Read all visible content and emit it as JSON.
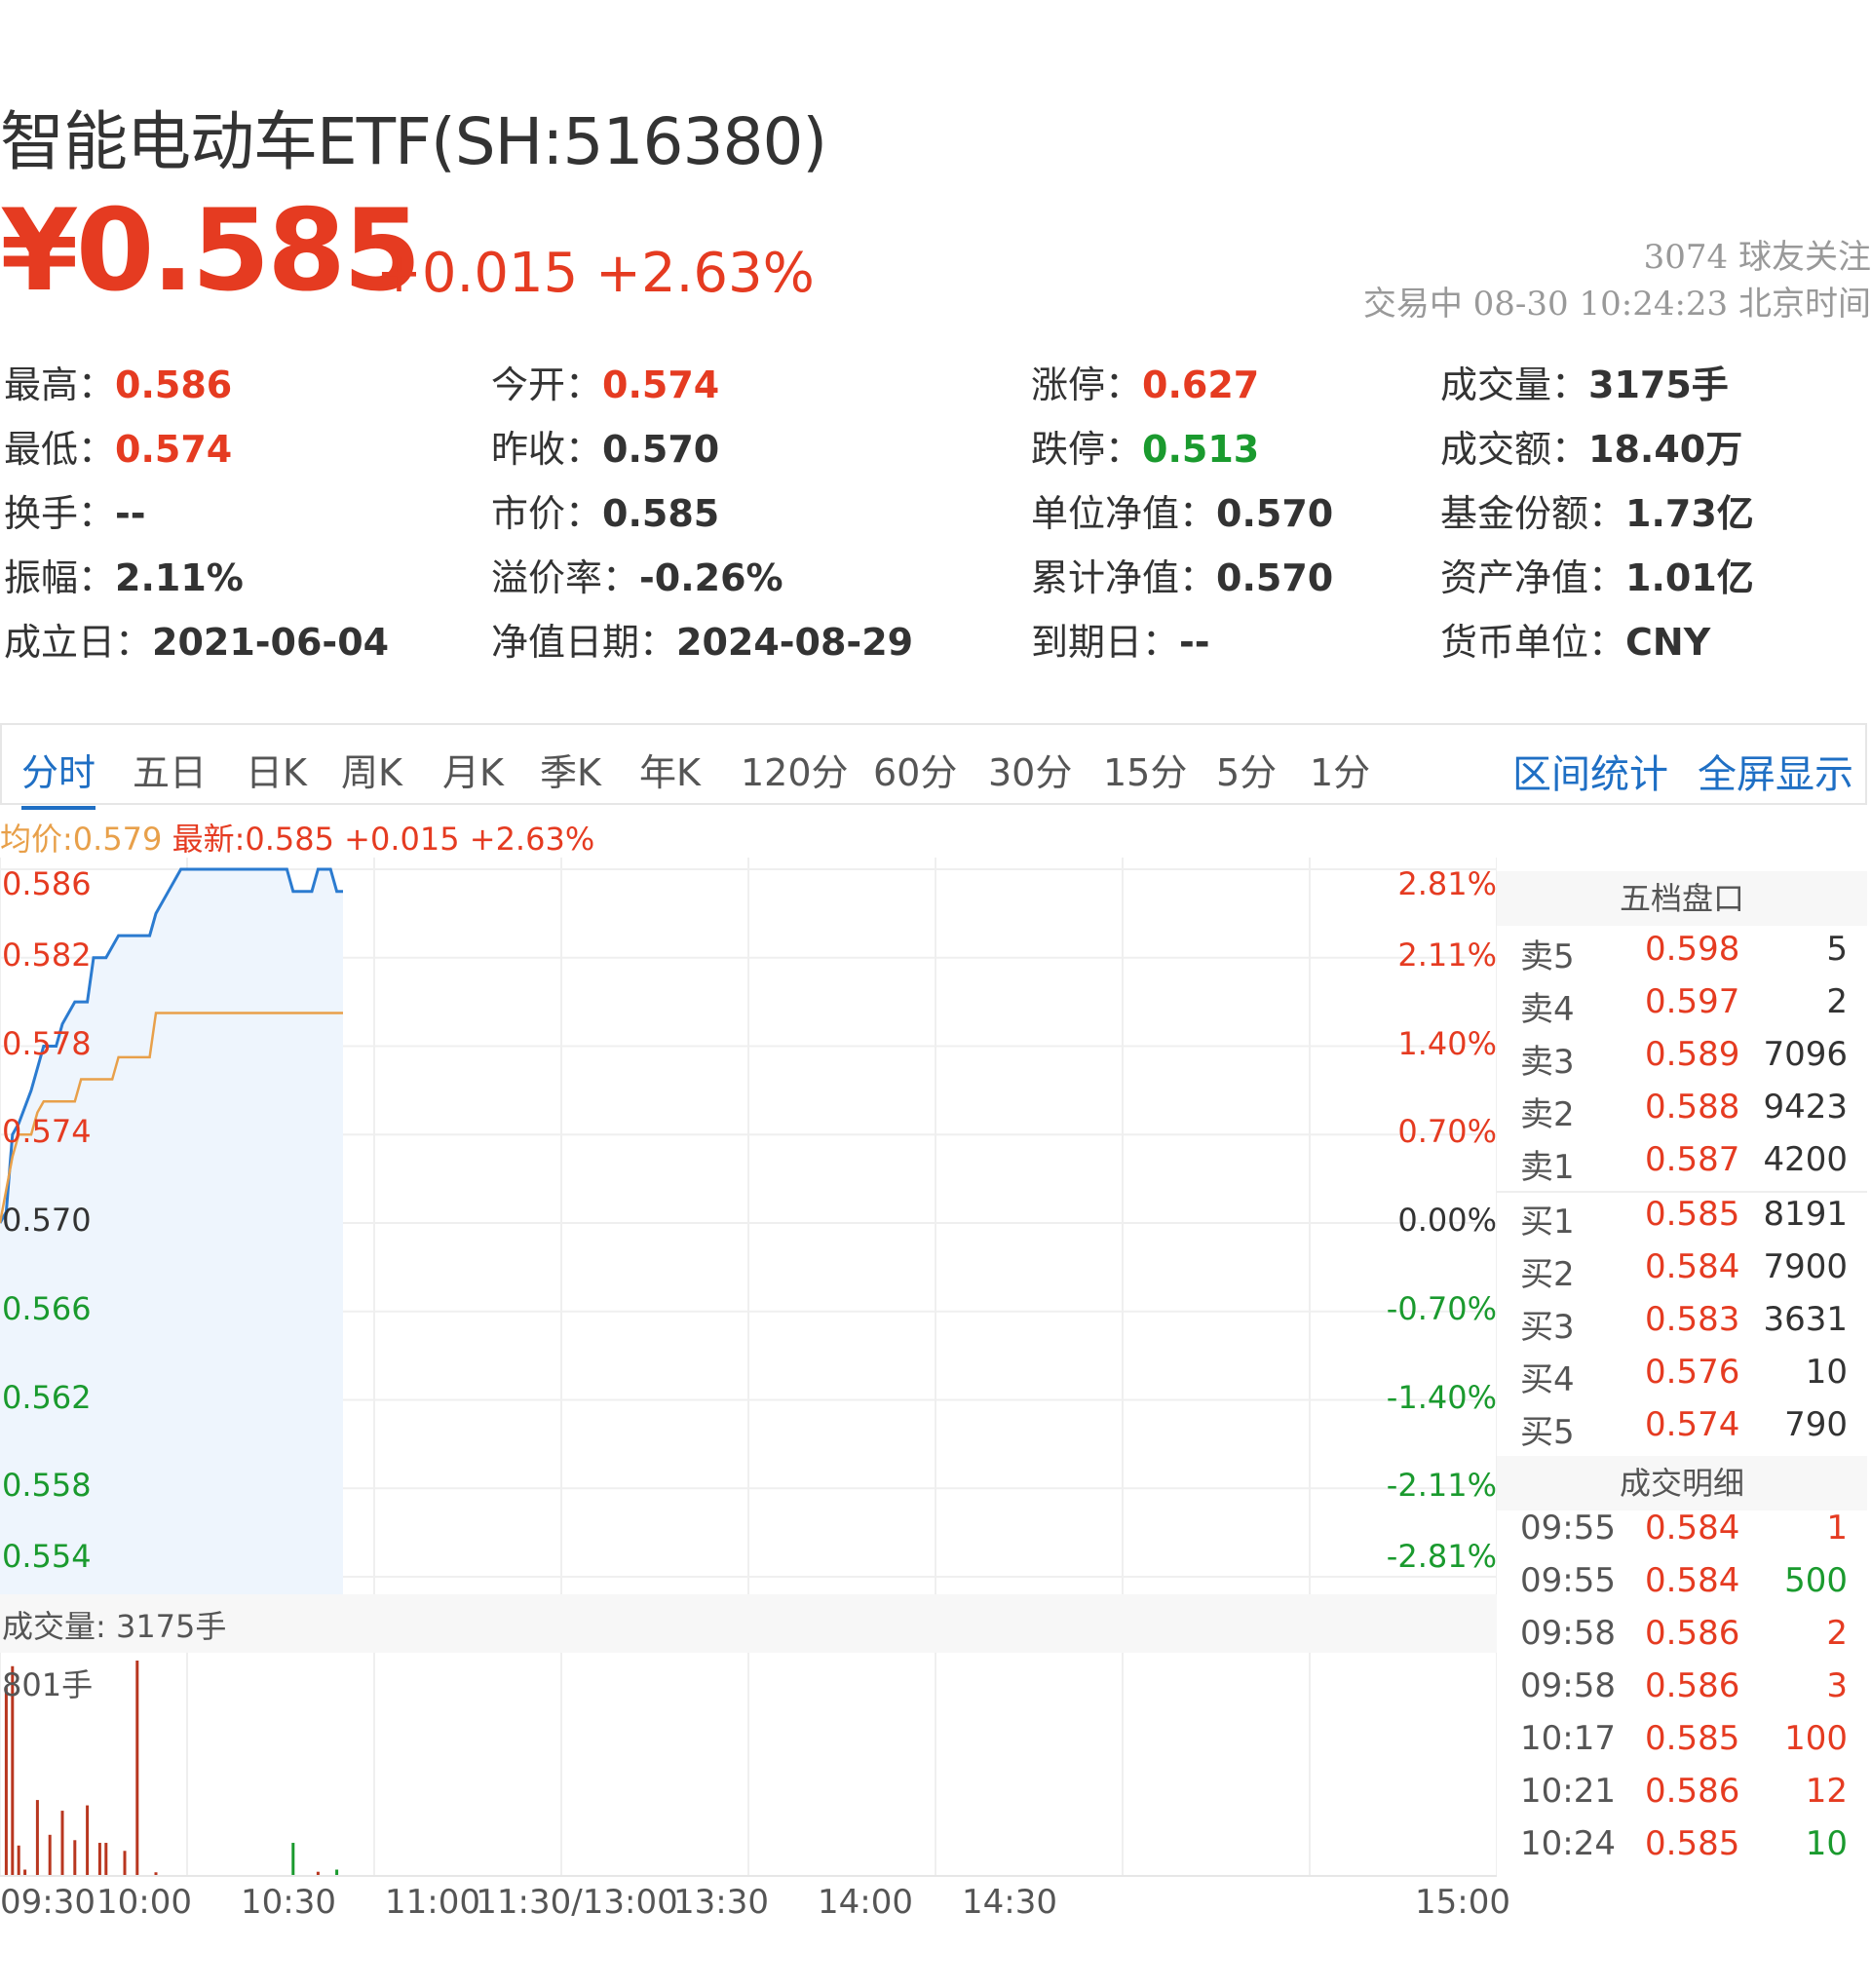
{
  "header": {
    "title": "智能电动车ETF(SH:516380)",
    "price": "¥0.585",
    "change": "+0.015 +2.63%",
    "followers": "3074 球友关注",
    "status": "交易中 08-30 10:24:23 北京时间"
  },
  "stats": [
    {
      "label": "最高：",
      "value": "0.586",
      "tone": "up"
    },
    {
      "label": "今开：",
      "value": "0.574",
      "tone": "up"
    },
    {
      "label": "涨停：",
      "value": "0.627",
      "tone": "up"
    },
    {
      "label": "成交量：",
      "value": "3175手",
      "tone": ""
    },
    {
      "label": "最低：",
      "value": "0.574",
      "tone": "up"
    },
    {
      "label": "昨收：",
      "value": "0.570",
      "tone": ""
    },
    {
      "label": "跌停：",
      "value": "0.513",
      "tone": "down"
    },
    {
      "label": "成交额：",
      "value": "18.40万",
      "tone": ""
    },
    {
      "label": "换手：",
      "value": "--",
      "tone": ""
    },
    {
      "label": "市价：",
      "value": "0.585",
      "tone": ""
    },
    {
      "label": "单位净值：",
      "value": "0.570",
      "tone": ""
    },
    {
      "label": "基金份额：",
      "value": "1.73亿",
      "tone": ""
    },
    {
      "label": "振幅：",
      "value": "2.11%",
      "tone": ""
    },
    {
      "label": "溢价率：",
      "value": "-0.26%",
      "tone": ""
    },
    {
      "label": "累计净值：",
      "value": "0.570",
      "tone": ""
    },
    {
      "label": "资产净值：",
      "value": "1.01亿",
      "tone": ""
    },
    {
      "label": "成立日：",
      "value": "2021-06-04",
      "tone": ""
    },
    {
      "label": "净值日期：",
      "value": "2024-08-29",
      "tone": ""
    },
    {
      "label": "到期日：",
      "value": "--",
      "tone": ""
    },
    {
      "label": "货币单位：",
      "value": "CNY",
      "tone": ""
    }
  ],
  "tabs": [
    "分时",
    "五日",
    "日K",
    "周K",
    "月K",
    "季K",
    "年K",
    "120分",
    "60分",
    "30分",
    "15分",
    "5分",
    "1分"
  ],
  "active_tab": 0,
  "tab_links": [
    "区间统计",
    "全屏显示"
  ],
  "legend": {
    "avg": "均价:0.579",
    "latest": "最新:0.585",
    "change": "+0.015",
    "pct": "+2.63%"
  },
  "colors": {
    "up": "#e53b21",
    "down": "#1a9a2e",
    "price_line": "#2b7bd0",
    "avg_line": "#e8a04a",
    "fill": "#eef5fd",
    "link": "#1f6fc4"
  },
  "chart_data": {
    "type": "line",
    "title": "",
    "prev_close": 0.57,
    "y_left_ticks": [
      "0.586",
      "0.582",
      "0.578",
      "0.574",
      "0.570",
      "0.566",
      "0.562",
      "0.558",
      "0.554"
    ],
    "y_right_ticks": [
      "2.81%",
      "2.11%",
      "1.40%",
      "0.70%",
      "0.00%",
      "-0.70%",
      "-1.40%",
      "-2.11%",
      "-2.81%"
    ],
    "ylim": [
      0.554,
      0.586
    ],
    "x_ticks": [
      "09:30",
      "10:00",
      "10:30",
      "11:00",
      "11:30/13:00",
      "13:30",
      "14:00",
      "14:30",
      "15:00"
    ],
    "x_range_minutes": [
      0,
      240
    ],
    "series": [
      {
        "key": "price",
        "t": [
          0,
          1,
          2,
          3,
          5,
          7,
          9,
          10,
          12,
          14,
          15,
          17,
          19,
          20,
          21,
          23,
          24,
          25,
          27,
          29,
          31,
          33,
          34,
          35,
          36,
          38,
          40,
          42,
          44,
          46,
          47,
          48,
          49,
          50,
          51,
          52,
          53,
          54,
          55
        ],
        "values": [
          0.57,
          0.5705,
          0.574,
          0.5745,
          0.576,
          0.578,
          0.578,
          0.579,
          0.58,
          0.58,
          0.582,
          0.582,
          0.583,
          0.583,
          0.583,
          0.583,
          0.583,
          0.584,
          0.585,
          0.586,
          0.586,
          0.586,
          0.586,
          0.586,
          0.586,
          0.586,
          0.586,
          0.586,
          0.586,
          0.586,
          0.585,
          0.585,
          0.585,
          0.585,
          0.586,
          0.586,
          0.586,
          0.585,
          0.585
        ]
      },
      {
        "key": "avg",
        "t": [
          0,
          2,
          3,
          5,
          6,
          7,
          9,
          10,
          12,
          13,
          18,
          19,
          24,
          25,
          55
        ],
        "values": [
          0.57,
          0.573,
          0.574,
          0.574,
          0.575,
          0.5755,
          0.5755,
          0.5755,
          0.5755,
          0.5765,
          0.5765,
          0.5775,
          0.5775,
          0.5795,
          0.5795
        ]
      }
    ]
  },
  "volume": {
    "title": "成交量: 3175手",
    "max_label": "801手",
    "max": 801,
    "bars": [
      {
        "t": 1,
        "v": 700,
        "c": "up"
      },
      {
        "t": 2,
        "v": 780,
        "c": "up"
      },
      {
        "t": 3,
        "v": 110,
        "c": "up"
      },
      {
        "t": 4,
        "v": 20,
        "c": "up"
      },
      {
        "t": 6,
        "v": 280,
        "c": "up"
      },
      {
        "t": 8,
        "v": 150,
        "c": "up"
      },
      {
        "t": 10,
        "v": 240,
        "c": "up"
      },
      {
        "t": 12,
        "v": 130,
        "c": "up"
      },
      {
        "t": 14,
        "v": 260,
        "c": "up"
      },
      {
        "t": 16,
        "v": 120,
        "c": "up"
      },
      {
        "t": 17,
        "v": 120,
        "c": "up"
      },
      {
        "t": 20,
        "v": 90,
        "c": "up"
      },
      {
        "t": 22,
        "v": 801,
        "c": "up"
      },
      {
        "t": 25,
        "v": 10,
        "c": "up"
      },
      {
        "t": 47,
        "v": 120,
        "c": "down"
      },
      {
        "t": 51,
        "v": 12,
        "c": "up"
      },
      {
        "t": 54,
        "v": 20,
        "c": "down"
      }
    ]
  },
  "orderbook": {
    "title": "五档盘口",
    "asks": [
      {
        "label": "卖5",
        "price": "0.598",
        "qty": "5"
      },
      {
        "label": "卖4",
        "price": "0.597",
        "qty": "2"
      },
      {
        "label": "卖3",
        "price": "0.589",
        "qty": "7096"
      },
      {
        "label": "卖2",
        "price": "0.588",
        "qty": "9423"
      },
      {
        "label": "卖1",
        "price": "0.587",
        "qty": "4200"
      }
    ],
    "bids": [
      {
        "label": "买1",
        "price": "0.585",
        "qty": "8191"
      },
      {
        "label": "买2",
        "price": "0.584",
        "qty": "7900"
      },
      {
        "label": "买3",
        "price": "0.583",
        "qty": "3631"
      },
      {
        "label": "买4",
        "price": "0.576",
        "qty": "10"
      },
      {
        "label": "买5",
        "price": "0.574",
        "qty": "790"
      }
    ]
  },
  "trades": {
    "title": "成交明细",
    "rows": [
      {
        "time": "09:55",
        "price": "0.584",
        "qty": "1",
        "side": "up"
      },
      {
        "time": "09:55",
        "price": "0.584",
        "qty": "500",
        "side": "down"
      },
      {
        "time": "09:58",
        "price": "0.586",
        "qty": "2",
        "side": "up"
      },
      {
        "time": "09:58",
        "price": "0.586",
        "qty": "3",
        "side": "up"
      },
      {
        "time": "10:17",
        "price": "0.585",
        "qty": "100",
        "side": "up"
      },
      {
        "time": "10:21",
        "price": "0.586",
        "qty": "12",
        "side": "up"
      },
      {
        "time": "10:24",
        "price": "0.585",
        "qty": "10",
        "side": "down"
      }
    ]
  }
}
